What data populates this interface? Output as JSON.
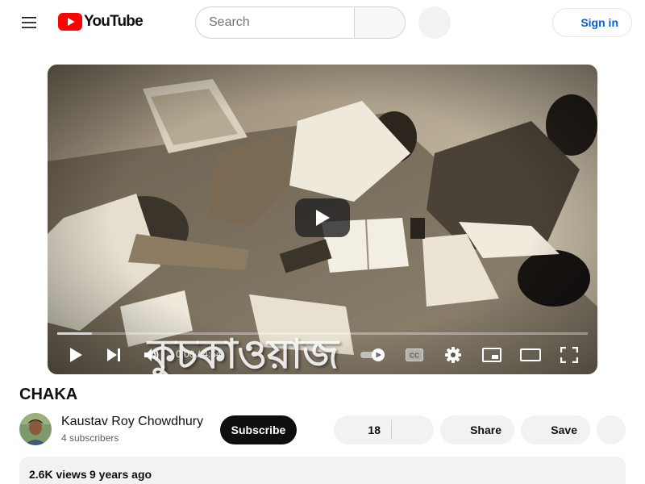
{
  "header": {
    "logo_text": "YouTube",
    "search_placeholder": "Search",
    "signin_label": "Sign in",
    "brand_color": "#ff0000",
    "link_color": "#065fd4"
  },
  "player": {
    "overlay_title": "কুচকাওয়াজ",
    "current_time": "0:00",
    "time_separator": " / ",
    "duration": "4:54",
    "loaded_fraction": 0.065,
    "icons": [
      "play-icon",
      "next-icon",
      "volume-icon",
      "autoplay-toggle-icon",
      "captions-icon",
      "settings-icon",
      "miniplayer-icon",
      "theater-icon",
      "fullscreen-icon"
    ]
  },
  "video": {
    "title": "CHAKA",
    "channel_name": "Kaustav Roy Chowdhury",
    "subscribers": "4 subscribers",
    "subscribe_label": "Subscribe",
    "like_count": "18",
    "share_label": "Share",
    "save_label": "Save",
    "views": "2.6K views",
    "published": "9 years ago"
  }
}
